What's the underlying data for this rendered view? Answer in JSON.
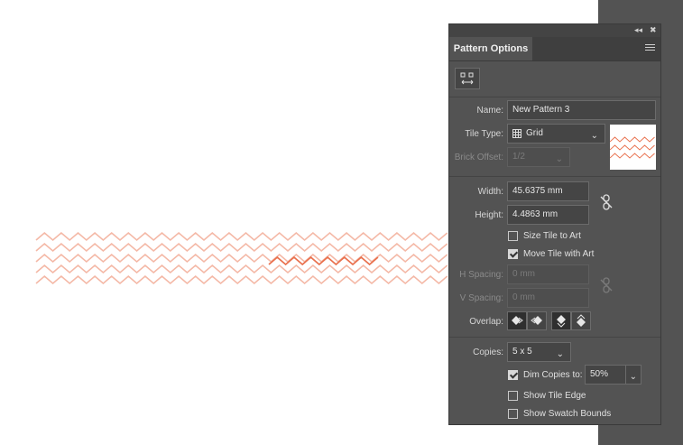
{
  "panel": {
    "title": "Pattern Options",
    "controls": {
      "collapse": "◂◂",
      "close": "✖"
    }
  },
  "form": {
    "name_label": "Name:",
    "name_value": "New Pattern 3",
    "tile_type_label": "Tile Type:",
    "tile_type_value": "Grid",
    "brick_offset_label": "Brick Offset:",
    "brick_offset_value": "1/2",
    "width_label": "Width:",
    "width_value": "45.6375 mm",
    "height_label": "Height:",
    "height_value": "4.4863 mm",
    "size_tile_to_art": {
      "label": "Size Tile to Art",
      "checked": false
    },
    "move_tile_with_art": {
      "label": "Move Tile with Art",
      "checked": true
    },
    "h_spacing_label": "H Spacing:",
    "h_spacing_value": "0 mm",
    "v_spacing_label": "V Spacing:",
    "v_spacing_value": "0 mm",
    "overlap_label": "Overlap:",
    "copies_label": "Copies:",
    "copies_value": "5 x 5",
    "dim_copies": {
      "label": "Dim Copies to:",
      "checked": true,
      "value": "50%"
    },
    "show_tile_edge": {
      "label": "Show Tile Edge",
      "checked": false
    },
    "show_swatch_bounds": {
      "label": "Show Swatch Bounds",
      "checked": false
    }
  },
  "colors": {
    "pattern_line": "#f4b8a6",
    "pattern_active": "#e9714e",
    "panel_bg": "#535353",
    "gutter_bg": "#535353"
  },
  "icons": [
    "collapse-icon",
    "close-icon",
    "panel-menu-icon",
    "tile-edit-icon",
    "grid-icon",
    "chevron-down-icon",
    "link-icon",
    "overlap-icon"
  ]
}
